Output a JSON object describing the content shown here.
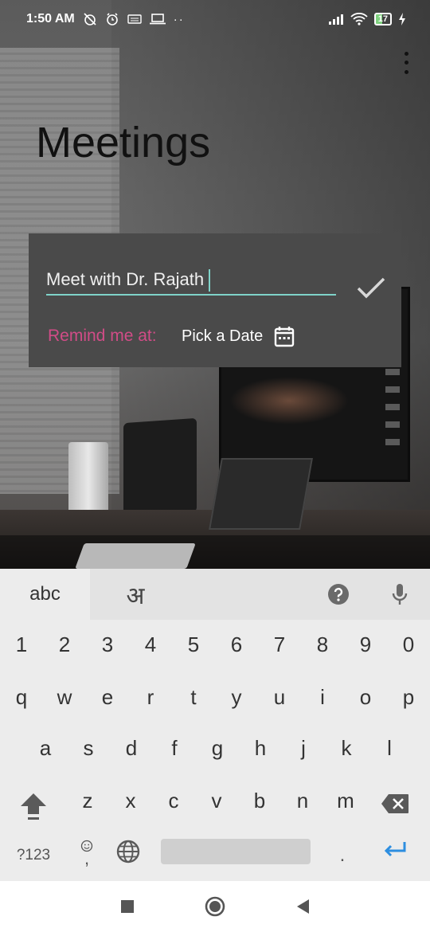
{
  "status_bar": {
    "time": "1:50 AM",
    "battery": "17",
    "icons": [
      "alarm-off-icon",
      "alarm-icon",
      "keyboard-icon",
      "laptop-icon",
      "more-dots-icon",
      "signal-icon",
      "wifi-icon",
      "battery-icon",
      "charging-icon"
    ]
  },
  "header": {
    "title": "Meetings"
  },
  "dialog": {
    "title_value": "Meet with Dr. Rajath",
    "remind_label": "Remind me at:",
    "pick_date_label": "Pick a Date"
  },
  "keyboard": {
    "tabs": [
      "abc",
      "अ"
    ],
    "numbers": [
      "1",
      "2",
      "3",
      "4",
      "5",
      "6",
      "7",
      "8",
      "9",
      "0"
    ],
    "row1": [
      "q",
      "w",
      "e",
      "r",
      "t",
      "y",
      "u",
      "i",
      "o",
      "p"
    ],
    "row2": [
      "a",
      "s",
      "d",
      "f",
      "g",
      "h",
      "j",
      "k",
      "l"
    ],
    "row3": [
      "z",
      "x",
      "c",
      "v",
      "b",
      "n",
      "m"
    ],
    "symbols_key": "?123",
    "comma_key": ",",
    "period_key": "."
  },
  "colors": {
    "accent": "#7fd3c9",
    "remind_label": "#d14c87",
    "card_bg": "#4a4a4a",
    "enter_key": "#2d8ee0"
  }
}
